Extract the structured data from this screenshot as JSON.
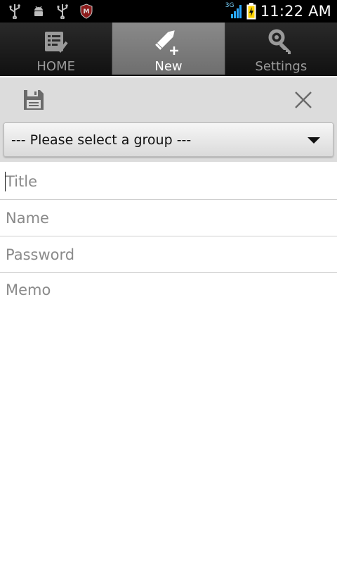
{
  "status_bar": {
    "network": "3G",
    "time": "11:22 AM",
    "left_icons": [
      "usb-icon",
      "android-debug-icon",
      "usb-icon",
      "mcafee-icon"
    ],
    "right_icons": [
      "signal-icon",
      "battery-charging-icon"
    ]
  },
  "tabs": [
    {
      "label": "HOME",
      "icon": "checklist-icon",
      "active": false
    },
    {
      "label": "New",
      "icon": "pencil-add-icon",
      "active": true
    },
    {
      "label": "Settings",
      "icon": "key-wrench-icon",
      "active": false
    }
  ],
  "toolbar": {
    "save_icon": "floppy-disk-icon",
    "close_icon": "close-icon"
  },
  "group_select": {
    "selected": "--- Please select a group ---"
  },
  "form": {
    "title_placeholder": "Title",
    "name_placeholder": "Name",
    "password_placeholder": "Password",
    "memo_placeholder": "Memo"
  },
  "colors": {
    "tab_active_bg": "#7c7c7c",
    "tab_inactive_bg": "#1a1a1a",
    "actionbar_bg": "#dcdcdc",
    "net_label": "#7ad3ff",
    "signal": "#2aa9ff",
    "battery": "#ffd400"
  }
}
